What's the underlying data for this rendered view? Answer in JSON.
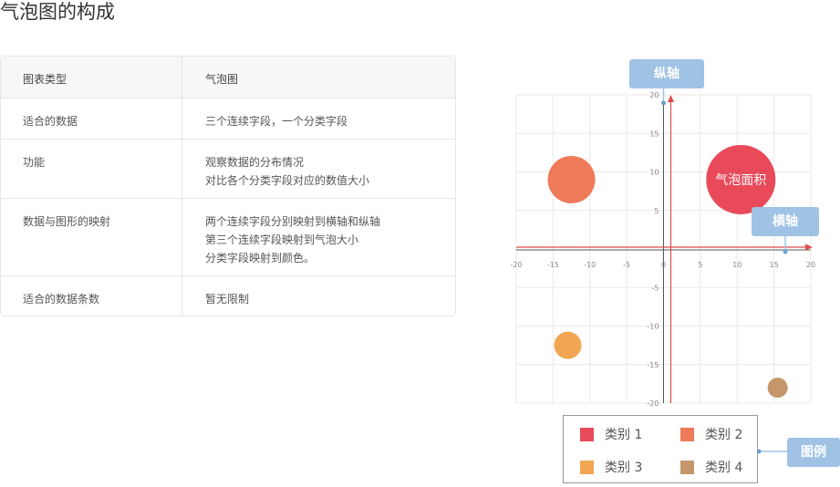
{
  "page": {
    "title": "气泡图的构成"
  },
  "table": {
    "rows": [
      {
        "key": "图表类型",
        "lines": [
          "气泡图"
        ]
      },
      {
        "key": "适合的数据",
        "lines": [
          "三个连续字段，一个分类字段"
        ]
      },
      {
        "key": "功能",
        "lines": [
          "观察数据的分布情况",
          "对比各个分类字段对应的数值大小"
        ]
      },
      {
        "key": "数据与图形的映射",
        "lines": [
          "两个连续字段分别映射到横轴和纵轴",
          "第三个连续字段映射到气泡大小",
          "分类字段映射到颜色。"
        ]
      },
      {
        "key": "适合的数据条数",
        "lines": [
          "暂无限制"
        ]
      }
    ]
  },
  "annotations": {
    "y_axis": "纵轴",
    "x_axis": "横轴",
    "legend": "图例",
    "bubble_area": "气泡面积"
  },
  "chart_data": {
    "type": "scatter",
    "xlim": [
      -20,
      20
    ],
    "ylim": [
      -20,
      20
    ],
    "x_ticks": [
      -20,
      -15,
      -10,
      -5,
      0,
      5,
      10,
      15,
      20
    ],
    "y_ticks": [
      20,
      15,
      10,
      5,
      -5,
      -10,
      -15,
      -20
    ],
    "grid": true,
    "legend_position": "bottom",
    "series": [
      {
        "name": "类别 1",
        "color": "#e84a5a",
        "points": [
          {
            "x": 10.5,
            "y": 9,
            "size": 38,
            "label": "气泡面积"
          }
        ]
      },
      {
        "name": "类别 2",
        "color": "#ef7a5a",
        "points": [
          {
            "x": -12.5,
            "y": 9,
            "size": 26
          }
        ]
      },
      {
        "name": "类别 3",
        "color": "#f2a654",
        "points": [
          {
            "x": -13,
            "y": -12.5,
            "size": 15
          }
        ]
      },
      {
        "name": "类别 4",
        "color": "#c4966a",
        "points": [
          {
            "x": 15.5,
            "y": -18,
            "size": 11
          }
        ]
      }
    ]
  }
}
